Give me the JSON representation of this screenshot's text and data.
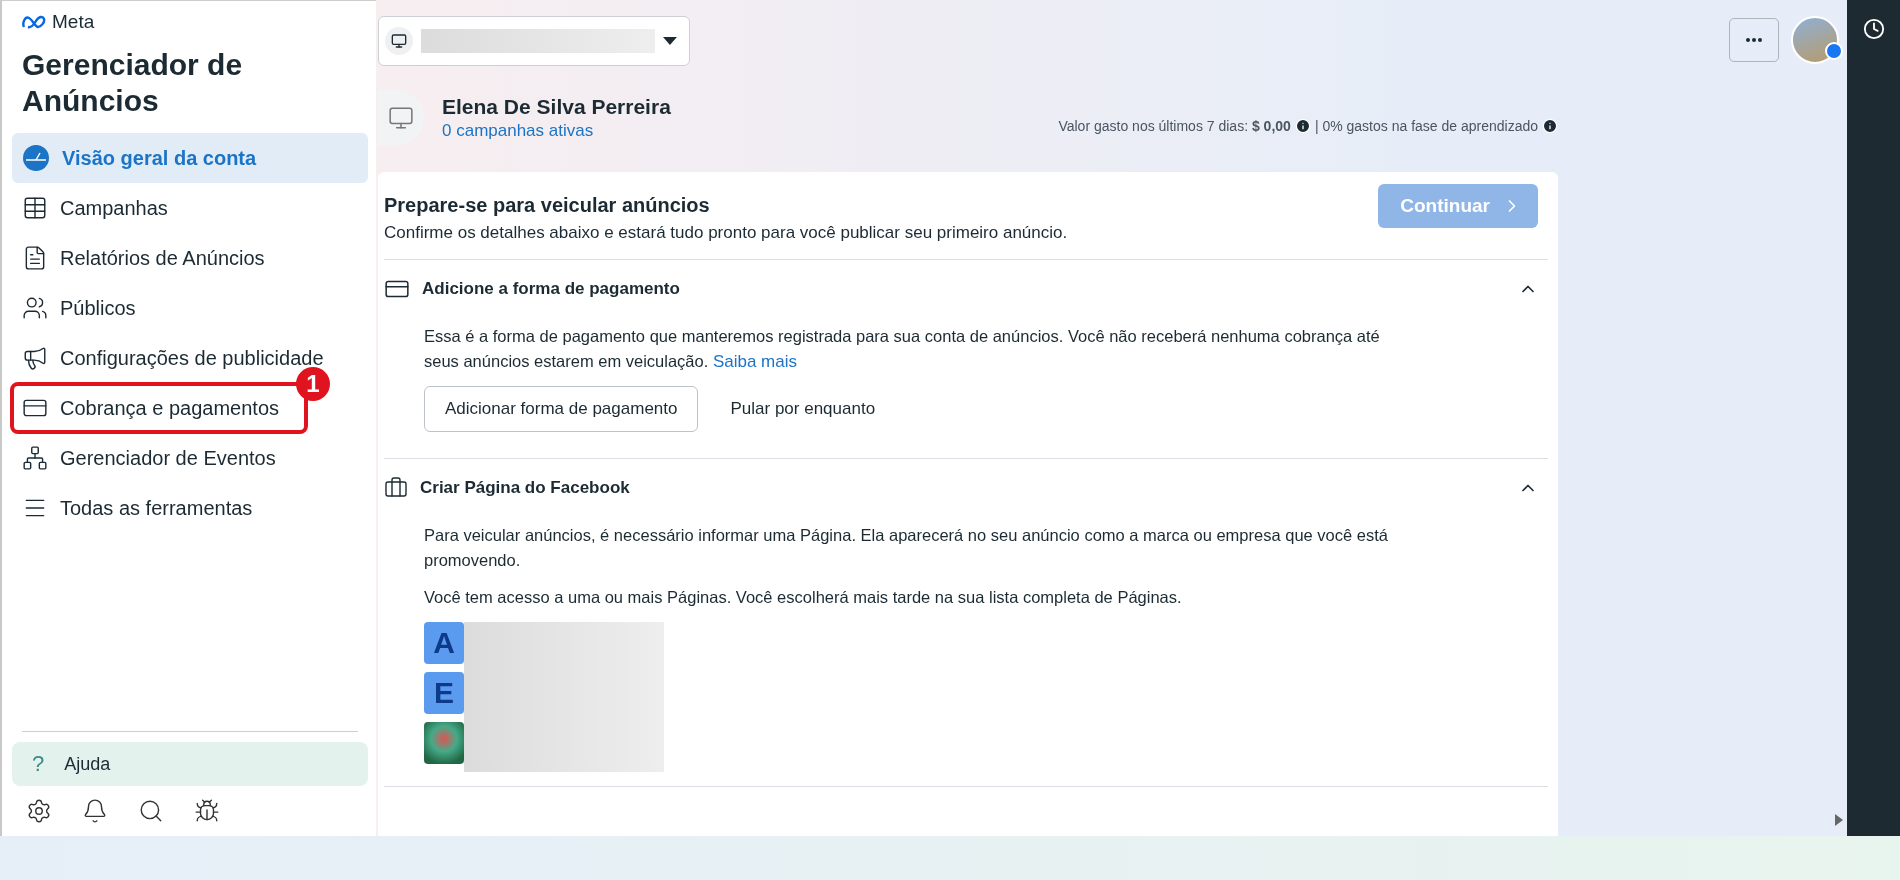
{
  "sidebar": {
    "brand": "Meta",
    "title": "Gerenciador de Anúncios",
    "items": [
      {
        "kind": "gauge",
        "label": "Visão geral da conta",
        "selected": true,
        "marked": false
      },
      {
        "kind": "table",
        "label": "Campanhas",
        "selected": false,
        "marked": false
      },
      {
        "kind": "report",
        "label": "Relatórios de Anúncios",
        "selected": false,
        "marked": false
      },
      {
        "kind": "people",
        "label": "Públicos",
        "selected": false,
        "marked": false
      },
      {
        "kind": "megaphone",
        "label": "Configurações de publicidade",
        "selected": false,
        "marked": false
      },
      {
        "kind": "card",
        "label": "Cobrança e pagamentos",
        "selected": false,
        "marked": true
      },
      {
        "kind": "events",
        "label": "Gerenciador de Eventos",
        "selected": false,
        "marked": false
      },
      {
        "kind": "menu",
        "label": "Todas as ferramentas",
        "selected": false,
        "marked": false
      }
    ],
    "callout_badge": "1",
    "help": {
      "icon": "?",
      "label": "Ajuda"
    }
  },
  "account": {
    "name": "Elena De Silva Perreira",
    "link": "0 campanhas ativas",
    "stats": [
      {
        "text": "Valor gasto nos últimos 7 dias: **$ 0,00**"
      },
      {
        "text": "| 0% gastos na fase de aprendizado"
      }
    ]
  },
  "setup": {
    "title": "Prepare-se para veicular anúncios",
    "subtitle": "Confirme os detalhes abaixo e estará tudo pronto para você publicar seu primeiro anúncio.",
    "continue": {
      "label": "Continuar",
      "disabled": true
    },
    "sections": [
      {
        "kind": "payment",
        "title": "Adicione a forma de pagamento",
        "expanded": true,
        "paragraphs": [
          {
            "text": "Essa é a forma de pagamento que manteremos registrada para sua conta de anúncios. Você não receberá nenhuma cobrança até seus anúncios estarem em veiculação.",
            "link": "Saiba mais"
          }
        ],
        "primary_button": "Adicionar forma de pagamento",
        "secondary_button": "Pular por enquanto"
      },
      {
        "kind": "page",
        "title": "Criar Página do Facebook",
        "expanded": true,
        "paragraphs": [
          {
            "text": "Para veicular anúncios, é necessário informar uma Página. Ela aparecerá no seu anúncio como a marca ou empresa que você está promovendo."
          },
          {
            "text": "Você tem acesso a uma ou mais Páginas. Você escolherá mais tarde na sua lista completa de Páginas."
          }
        ],
        "pages": [
          {
            "kind": "letter",
            "letter": "A"
          },
          {
            "kind": "letter",
            "letter": "E"
          },
          {
            "kind": "photo"
          }
        ]
      }
    ]
  }
}
